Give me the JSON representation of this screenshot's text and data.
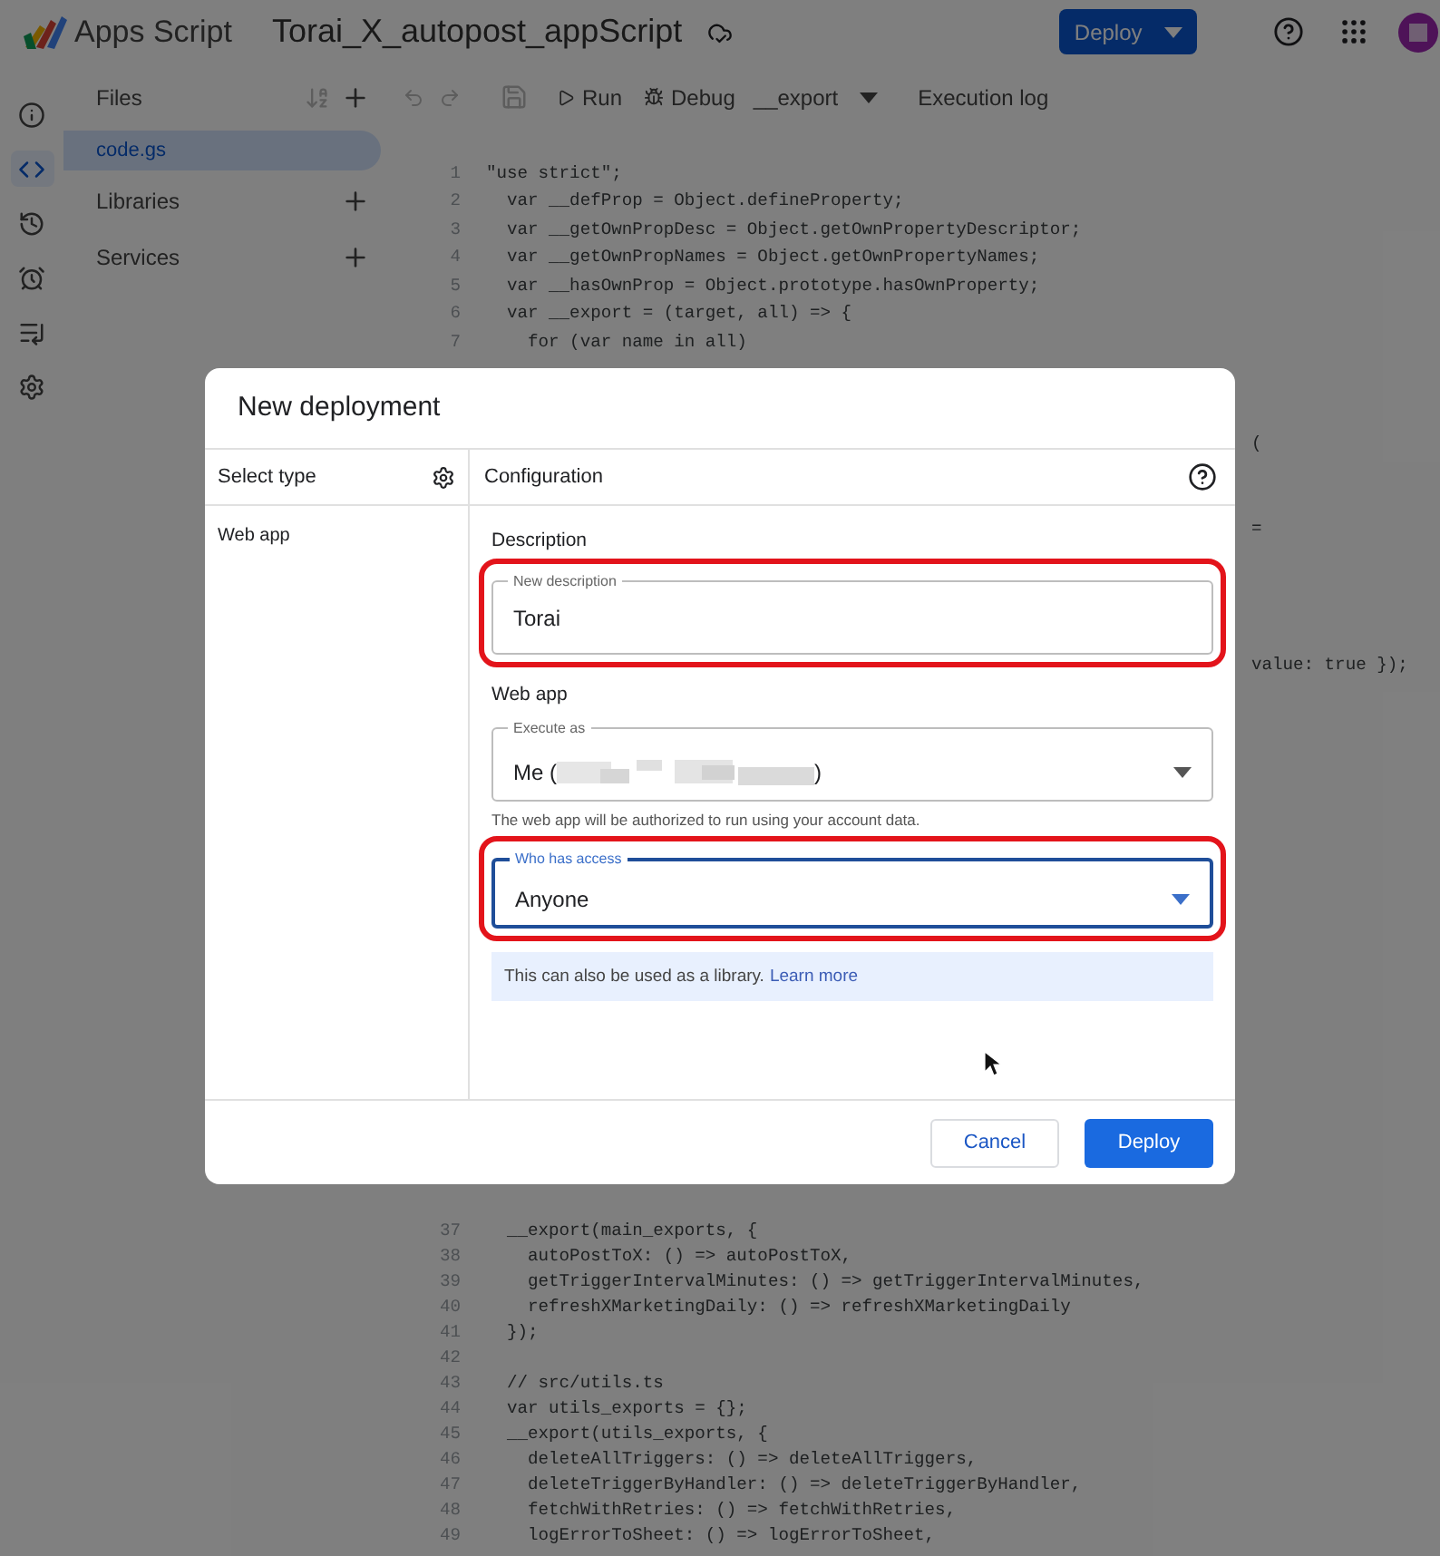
{
  "header": {
    "product": "Apps Script",
    "project_title": "Torai_X_autopost_appScript",
    "deploy_button": "Deploy"
  },
  "rail": [
    {
      "kind": "info",
      "selected": false
    },
    {
      "kind": "code",
      "selected": true
    },
    {
      "kind": "history",
      "selected": false
    },
    {
      "kind": "alarm",
      "selected": false
    },
    {
      "kind": "executions",
      "selected": false
    },
    {
      "kind": "settings",
      "selected": false
    }
  ],
  "files_panel": {
    "title": "Files",
    "files": [
      {
        "name": "code.gs",
        "selected": true
      }
    ],
    "sections": [
      "Libraries",
      "Services"
    ]
  },
  "toolbar": {
    "run": "Run",
    "debug": "Debug",
    "function": "__export",
    "log": "Execution log"
  },
  "code_top": [
    {
      "n": "1",
      "code": "\"use strict\";"
    },
    {
      "n": "2",
      "code": "  var __defProp = Object.defineProperty;"
    },
    {
      "n": "3",
      "code": "  var __getOwnPropDesc = Object.getOwnPropertyDescriptor;"
    },
    {
      "n": "4",
      "code": "  var __getOwnPropNames = Object.getOwnPropertyNames;"
    },
    {
      "n": "5",
      "code": "  var __hasOwnProp = Object.prototype.hasOwnProperty;"
    },
    {
      "n": "6",
      "code": "  var __export = (target, all) => {"
    },
    {
      "n": "7",
      "code": "    for (var name in all)"
    }
  ],
  "code_fragments": [
    "(",
    "=",
    "value: true });"
  ],
  "code_bottom": [
    {
      "n": "37",
      "code": "  __export(main_exports, {"
    },
    {
      "n": "38",
      "code": "    autoPostToX: () => autoPostToX,"
    },
    {
      "n": "39",
      "code": "    getTriggerIntervalMinutes: () => getTriggerIntervalMinutes,"
    },
    {
      "n": "40",
      "code": "    refreshXMarketingDaily: () => refreshXMarketingDaily"
    },
    {
      "n": "41",
      "code": "  });"
    },
    {
      "n": "42"
    },
    {
      "n": "43",
      "code": "  // src/utils.ts"
    },
    {
      "n": "44",
      "code": "  var utils_exports = {};"
    },
    {
      "n": "45",
      "code": "  __export(utils_exports, {"
    },
    {
      "n": "46",
      "code": "    deleteAllTriggers: () => deleteAllTriggers,"
    },
    {
      "n": "47",
      "code": "    deleteTriggerByHandler: () => deleteTriggerByHandler,"
    },
    {
      "n": "48",
      "code": "    fetchWithRetries: () => fetchWithRetries,"
    },
    {
      "n": "49",
      "code": "    logErrorToSheet: () => logErrorToSheet,"
    }
  ],
  "dialog": {
    "title": "New deployment",
    "select_type": "Select type",
    "types": [
      {
        "label": "Web app",
        "selected": false
      }
    ],
    "configuration": "Configuration",
    "description": {
      "section": "Description",
      "label": "New description",
      "value": "Torai",
      "highlighted": true
    },
    "web_app": {
      "section": "Web app",
      "execute_as": {
        "label": "Execute as",
        "value_start": "Me (",
        "redacted": true,
        "value_end": ")",
        "highlighted": false
      },
      "helper": "The web app will be authorized to run using your account data.",
      "access": {
        "label": "Who has access",
        "value": "Anyone",
        "focused": true,
        "highlighted": true
      }
    },
    "banner": {
      "text": "This can also be used as a library.",
      "link": "Learn more"
    },
    "buttons": [
      {
        "label": "Cancel",
        "kind": "secondary"
      },
      {
        "label": "Deploy",
        "kind": "primary"
      }
    ]
  }
}
